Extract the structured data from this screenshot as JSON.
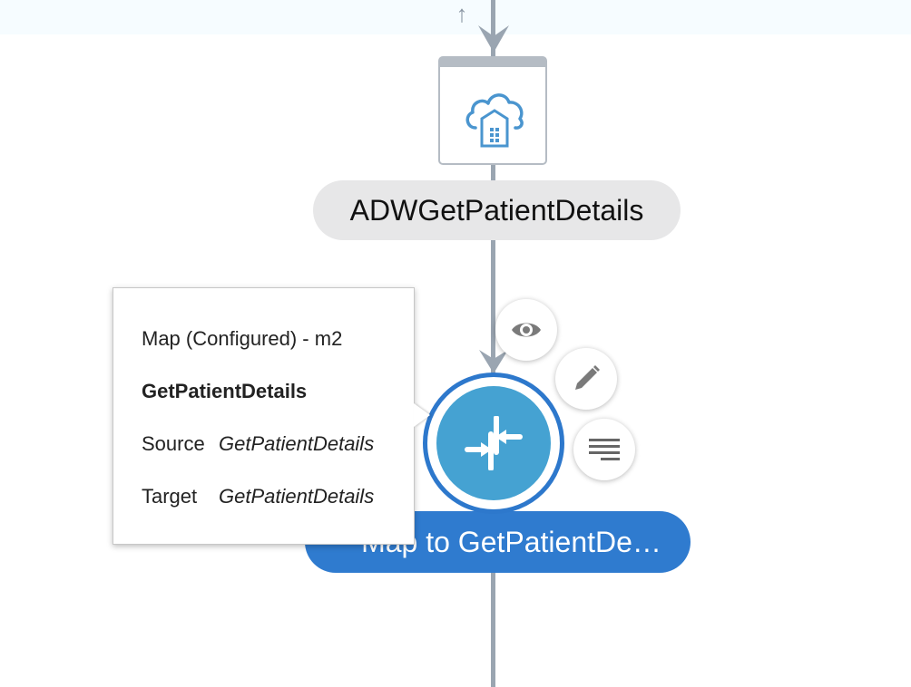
{
  "flow": {
    "nodes": [
      {
        "label": "ADWGetPatientDetails",
        "icon": "cloud-warehouse-icon"
      },
      {
        "label": "Map to GetPatientDe…",
        "icon": "map-arrows-icon"
      }
    ]
  },
  "actions": [
    "eye-icon",
    "pencil-icon",
    "menu-lines-icon"
  ],
  "tooltip": {
    "line1": "Map (Configured) - m2",
    "line2": "GetPatientDetails",
    "source_label": "Source",
    "source_value": "GetPatientDetails",
    "target_label": "Target",
    "target_value": "GetPatientDetails"
  },
  "colors": {
    "accent": "#2f7bcf",
    "node_fill": "#45a2d2",
    "flow_line": "#9aa5b1",
    "icon_blue": "#4a95cf"
  }
}
